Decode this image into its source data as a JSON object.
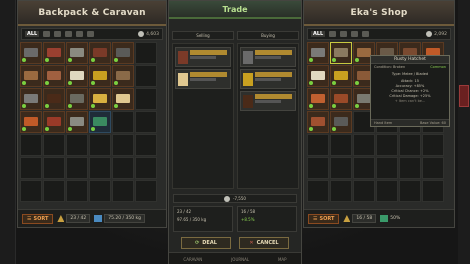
{
  "left_panel": {
    "title": "Backpack & Caravan",
    "filter": {
      "all_label": "ALL",
      "money": "4,603"
    },
    "sort_label": "SORT",
    "capacity": "23 / 42",
    "weight": "75.20 / 350 kg"
  },
  "right_panel": {
    "title": "Eka's Shop",
    "filter": {
      "all_label": "ALL",
      "money": "2,092"
    },
    "sort_label": "SORT",
    "capacity": "16 / 58",
    "condition": "50%"
  },
  "trade": {
    "title": "Trade",
    "selling_label": "Selling",
    "buying_label": "Buying",
    "total": "-7,550",
    "left_capacity": "23 / 42",
    "left_weight": "97.65 / 350 kg",
    "right_capacity": "16 / 58",
    "right_pct": "+8.5%",
    "deal_label": "DEAL",
    "cancel_label": "CANCEL",
    "bottom_tabs": [
      "CARAVAN",
      "JOURNAL",
      "MAP"
    ]
  },
  "tooltip": {
    "title": "Rusty Hatchet",
    "condition_label": "Condition",
    "condition_value": "Broken",
    "rarity": "Common",
    "type_line": "Type: Melee / Bladed",
    "stats": [
      "Attack: 15",
      "Accuracy: +85%",
      "Critical Chance: +2%",
      "Critical Damage: +25%"
    ],
    "footer_left": "Hand Item",
    "footer_right": "Base Value: 60",
    "note": "+ Item can't be..."
  }
}
